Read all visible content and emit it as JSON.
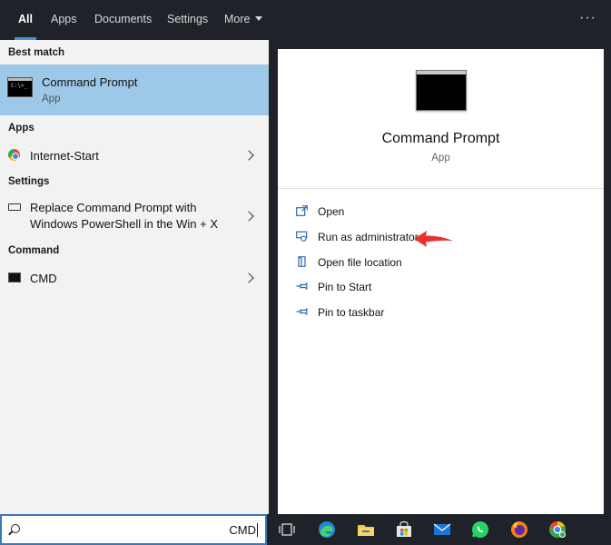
{
  "tabs": [
    {
      "label": "All",
      "active": true
    },
    {
      "label": "Apps",
      "active": false
    },
    {
      "label": "Documents",
      "active": false
    },
    {
      "label": "Settings",
      "active": false
    },
    {
      "label": "More",
      "active": false
    }
  ],
  "options_glyph": "···",
  "left_panel": {
    "best_match": {
      "header": "Best match",
      "title": "Command Prompt",
      "subtitle": "App",
      "icon": "command-prompt-icon"
    },
    "apps": {
      "header": "Apps",
      "items": [
        {
          "label": "Internet-Start",
          "icon": "chrome-icon"
        }
      ]
    },
    "settings": {
      "header": "Settings",
      "items": [
        {
          "line1": "Replace Command Prompt with",
          "line2": "Windows PowerShell in the Win + X",
          "icon": "monitor-icon"
        }
      ]
    },
    "command": {
      "header": "Command",
      "items": [
        {
          "label": "CMD",
          "icon": "command-prompt-icon"
        }
      ]
    }
  },
  "right_panel": {
    "title": "Command Prompt",
    "subtitle": "App",
    "actions": [
      {
        "label": "Open",
        "icon": "open-icon"
      },
      {
        "label": "Run as administrator",
        "icon": "shield-icon"
      },
      {
        "label": "Open file location",
        "icon": "file-location-icon"
      },
      {
        "label": "Pin to Start",
        "icon": "pin-icon"
      },
      {
        "label": "Pin to taskbar",
        "icon": "pin-icon"
      }
    ],
    "annotation_color": "#e8322d"
  },
  "taskbar": {
    "search_value": "CMD",
    "icons": [
      "task-view-icon",
      "edge-icon",
      "file-explorer-icon",
      "store-icon",
      "mail-icon",
      "whatsapp-icon",
      "firefox-icon",
      "chrome-icon"
    ]
  },
  "colors": {
    "dark_bg": "#1f2329",
    "selected_row": "#9ec8e8",
    "accent": "#4a90d6",
    "left_bg": "#f2f2f2"
  }
}
